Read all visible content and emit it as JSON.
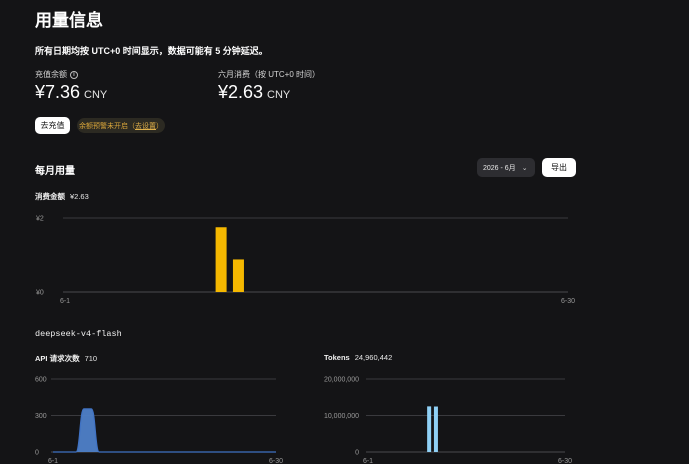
{
  "page": {
    "title": "用量信息",
    "notice": "所有日期均按 UTC+0 时间显示，数据可能有 5 分钟延迟。"
  },
  "balance": {
    "label": "充值余额",
    "info_icon": "info-icon",
    "amount": "¥7.36",
    "unit": "CNY"
  },
  "monthly_spend": {
    "label": "六月消费（按 UTC+0 时间）",
    "amount": "¥2.63",
    "unit": "CNY"
  },
  "actions": {
    "recharge_label": "去充值",
    "alert_text": "余额预警未开启（",
    "alert_link": "去设置",
    "alert_close": "）"
  },
  "monthly_usage": {
    "title": "每月用量",
    "month_select": "2026 - 6月",
    "export_label": "导出"
  },
  "spend_chart": {
    "label": "消费金额",
    "total": "¥2.63"
  },
  "model": {
    "name": "deepseek-v4-flash"
  },
  "api_chart": {
    "label": "API 请求次数",
    "total": "710"
  },
  "tokens_chart": {
    "label": "Tokens",
    "total": "24,960,442"
  },
  "colors": {
    "spend_bar": "#f5b800",
    "api_area": "#4e7fc8",
    "tokens_bar": "#8fd0f5",
    "grid": "#3a3a3e"
  },
  "chart_data": [
    {
      "type": "bar",
      "x_tick_labels": [
        "6-1",
        "6-30"
      ],
      "y_tick_labels": [
        "¥0",
        "¥2"
      ],
      "ylim": [
        0,
        2
      ],
      "x": [
        "6-10",
        "6-11"
      ],
      "values": [
        1.75,
        0.88
      ]
    },
    {
      "type": "area",
      "x_tick_labels": [
        "6-1",
        "6-30"
      ],
      "y_tick_labels": [
        "0",
        "300",
        "600"
      ],
      "ylim": [
        0,
        600
      ],
      "x": [
        "6-1",
        "6-2",
        "6-3",
        "6-4",
        "6-5",
        "6-6",
        "6-7",
        "6-8",
        "6-9",
        "6-10",
        "6-11",
        "6-12",
        "6-13",
        "6-14",
        "6-15",
        "6-16",
        "6-17",
        "6-18",
        "6-19",
        "6-20",
        "6-21",
        "6-22",
        "6-23",
        "6-24",
        "6-25",
        "6-26",
        "6-27",
        "6-28",
        "6-29",
        "6-30"
      ],
      "values": [
        0,
        0,
        0,
        0,
        355,
        355,
        0,
        0,
        0,
        0,
        0,
        0,
        0,
        0,
        0,
        0,
        0,
        0,
        0,
        0,
        0,
        0,
        0,
        0,
        0,
        0,
        0,
        0,
        0,
        0
      ]
    },
    {
      "type": "bar",
      "x_tick_labels": [
        "6-1",
        "6-30"
      ],
      "y_tick_labels": [
        "0",
        "10,000,000",
        "20,000,000"
      ],
      "ylim": [
        0,
        20000000
      ],
      "x": [
        "6-10",
        "6-11"
      ],
      "values": [
        12500000,
        12460442
      ]
    }
  ]
}
